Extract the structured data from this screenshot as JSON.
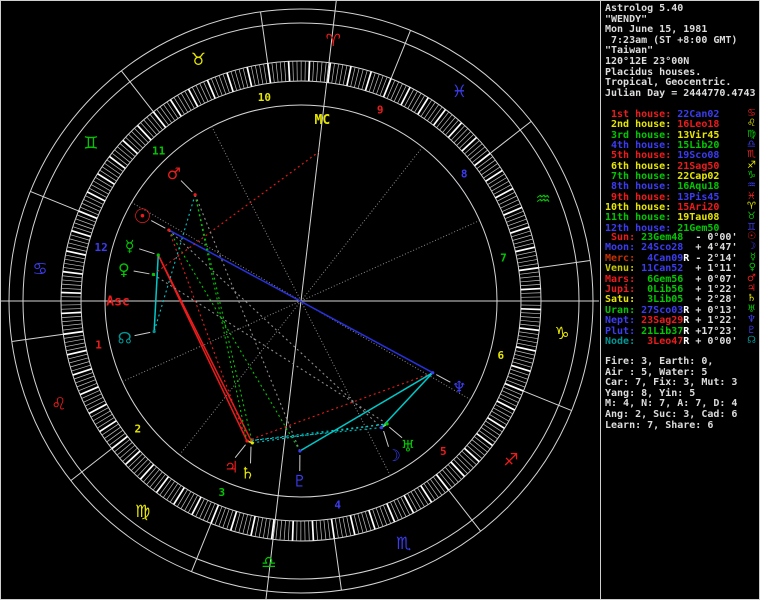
{
  "app_title": "Astrolog 5.40",
  "panel": {
    "header_lines": [
      "Astrolog 5.40",
      "\"WENDY\"",
      "Mon June 15, 1981",
      " 7:23am (ST +8:00 GMT)",
      "\"Taiwan\"",
      "120°12E 23°00N",
      "Placidus houses.",
      "Tropical, Geocentric.",
      "Julian Day = 2444770.4743"
    ],
    "houses": [
      {
        "label": "1st house:",
        "value": "22Can02"
      },
      {
        "label": "2nd house:",
        "value": "16Leo18"
      },
      {
        "label": "3rd house:",
        "value": "13Vir45"
      },
      {
        "label": "4th house:",
        "value": "15Lib20"
      },
      {
        "label": "5th house:",
        "value": "19Sco08"
      },
      {
        "label": "6th house:",
        "value": "21Sag50"
      },
      {
        "label": "7th house:",
        "value": "22Cap02"
      },
      {
        "label": "8th house:",
        "value": "16Aqu18"
      },
      {
        "label": "9th house:",
        "value": "13Pis45"
      },
      {
        "label": "10th house:",
        "value": "15Ari20"
      },
      {
        "label": "11th house:",
        "value": "19Tau08"
      },
      {
        "label": "12th house:",
        "value": "21Gem50"
      }
    ],
    "planets": [
      {
        "name": "Sun",
        "value": "23Gem48",
        "retro": false,
        "velocity": "- 0°00'",
        "name_color": "#ec1c1c",
        "symbol_color": "#ec1c1c"
      },
      {
        "name": "Moon",
        "value": "24Sco28",
        "retro": false,
        "velocity": "+ 4°47'",
        "name_color": "#3c3cf0",
        "symbol_color": "#3c3cf0"
      },
      {
        "name": "Merc",
        "value": "4Can09",
        "retro": true,
        "velocity": "- 2°14'",
        "name_color": "#c83200",
        "symbol_color": "#00c800"
      },
      {
        "name": "Venu",
        "value": "11Can52",
        "retro": false,
        "velocity": "+ 1°11'",
        "name_color": "#c8c800",
        "symbol_color": "#00c800"
      },
      {
        "name": "Mars",
        "value": "6Gem56",
        "retro": false,
        "velocity": "+ 0°07'",
        "name_color": "#ec1c1c",
        "symbol_color": "#ec1c1c"
      },
      {
        "name": "Jupi",
        "value": "0Lib56",
        "retro": false,
        "velocity": "+ 1°22'",
        "name_color": "#ec1c1c",
        "symbol_color": "#ec1c1c"
      },
      {
        "name": "Satu",
        "value": "3Lib05",
        "retro": false,
        "velocity": "+ 2°28'",
        "name_color": "#e6e600",
        "symbol_color": "#e6e600"
      },
      {
        "name": "Uran",
        "value": "27Sco03",
        "retro": true,
        "velocity": "+ 0°13'",
        "name_color": "#00c800",
        "symbol_color": "#00c800"
      },
      {
        "name": "Nept",
        "value": "23Sag29",
        "retro": true,
        "velocity": "+ 1°22'",
        "name_color": "#3c3cf0",
        "symbol_color": "#3c3cf0"
      },
      {
        "name": "Plut",
        "value": "21Lib37",
        "retro": true,
        "velocity": "+17°23'",
        "name_color": "#3c3cf0",
        "symbol_color": "#3c3cf0"
      },
      {
        "name": "Node",
        "value": "3Leo47",
        "retro": true,
        "velocity": "+ 0°00'",
        "name_color": "#009696",
        "symbol_color": "#009696"
      }
    ],
    "stats_lines": [
      "Fire: 3, Earth: 0,",
      "Air : 5, Water: 5",
      "Car: 7, Fix: 3, Mut: 3",
      "Yang: 8, Yin: 5",
      "M: 4, N: 7, A: 7, D: 4",
      "Ang: 2, Suc: 3, Cad: 6",
      "Learn: 7, Share: 6"
    ]
  },
  "wheel": {
    "asc_label": "Asc",
    "mc_label": "MC",
    "house_numbers": [
      "1",
      "2",
      "3",
      "4",
      "5",
      "6",
      "7",
      "8",
      "9",
      "10",
      "11",
      "12"
    ],
    "aspects": [
      {
        "a": "Sun",
        "b": "Nept",
        "type": "opp"
      },
      {
        "a": "Sun",
        "b": "Jupi",
        "type": "squ"
      },
      {
        "a": "Sun",
        "b": "Plut",
        "type": "tri"
      },
      {
        "a": "Sun",
        "b": "Moon",
        "type": "qui"
      },
      {
        "a": "Moon",
        "b": "Uran",
        "type": "con"
      },
      {
        "a": "Moon",
        "b": "Nept",
        "type": "ssx"
      },
      {
        "a": "Moon",
        "b": "Jupi",
        "type": "sex"
      },
      {
        "a": "Merc",
        "b": "Jupi",
        "type": "squ"
      },
      {
        "a": "Merc",
        "b": "Satu",
        "type": "squ"
      },
      {
        "a": "Merc",
        "b": "Node",
        "type": "ssx"
      },
      {
        "a": "Venu",
        "b": "Uran",
        "type": "sesq"
      },
      {
        "a": "Venu",
        "b": "MC",
        "type": "squ",
        "style": "dot"
      },
      {
        "a": "Mars",
        "b": "Jupi",
        "type": "tri"
      },
      {
        "a": "Mars",
        "b": "Satu",
        "type": "tri"
      },
      {
        "a": "Mars",
        "b": "Plut",
        "type": "sesq"
      },
      {
        "a": "Mars",
        "b": "Node",
        "type": "sex"
      },
      {
        "a": "Jupi",
        "b": "Satu",
        "type": "con"
      },
      {
        "a": "Jupi",
        "b": "Uran",
        "type": "sex"
      },
      {
        "a": "Jupi",
        "b": "Nept",
        "type": "squ"
      },
      {
        "a": "Satu",
        "b": "Uran",
        "type": "sex"
      },
      {
        "a": "Nept",
        "b": "Plut",
        "type": "sex"
      }
    ]
  },
  "colors": {
    "red": "#ec1c1c",
    "yellow": "#e6e600",
    "green": "#00c800",
    "blue": "#3c3cf0",
    "cyan": "#00c8c8",
    "dkcyan": "#009696",
    "white": "#dcdcdc",
    "gray": "#8c8c8c",
    "line": "#d4d4d4",
    "retro": "#ffffff"
  }
}
